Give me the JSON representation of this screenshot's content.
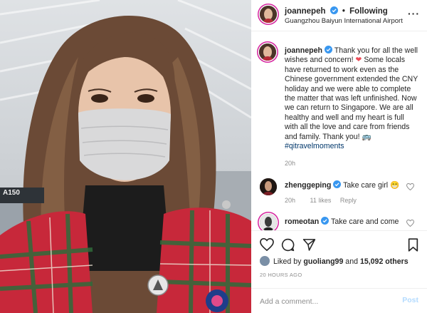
{
  "post": {
    "username": "joannepeh",
    "follow_label": "Following",
    "location": "Guangzhou Baiyun International Airport",
    "gate_sign": "A150"
  },
  "caption": {
    "username": "joannepeh",
    "text_part1": "Thank you for all the well wishes and concern! ",
    "heart_emoji": "❤",
    "text_part2": " Some locals have returned to work even as the Chinese government extended the CNY holiday and we were able to complete the matter that was left unfinished. Now we can return to Singapore. We are all healthy and well and my heart is full with all the love and care from friends and family. Thank you! ",
    "emoji2": "🚌",
    "hashtag": "#qitravelmoments",
    "time": "20h"
  },
  "comments": [
    {
      "username": "zhenggeping",
      "text": "Take care girl ",
      "emoji": "😁",
      "time": "20h",
      "likes": "11 likes",
      "reply": "Reply"
    },
    {
      "username": "romeotan",
      "text": "Take care and come"
    }
  ],
  "likes": {
    "prefix": "Liked by",
    "user": "guoliang99",
    "and": "and",
    "count": "15,092 others"
  },
  "timestamp": "20 HOURS AGO",
  "comment_box": {
    "placeholder": "Add a comment...",
    "post_label": "Post"
  },
  "colors": {
    "verified": "#3897f0",
    "link": "#00376b",
    "muted": "#8e8e8e",
    "post_button": "#b3dbff"
  },
  "icons": [
    "verified-icon",
    "more-icon",
    "heart-icon",
    "comment-icon",
    "share-icon",
    "bookmark-icon"
  ]
}
